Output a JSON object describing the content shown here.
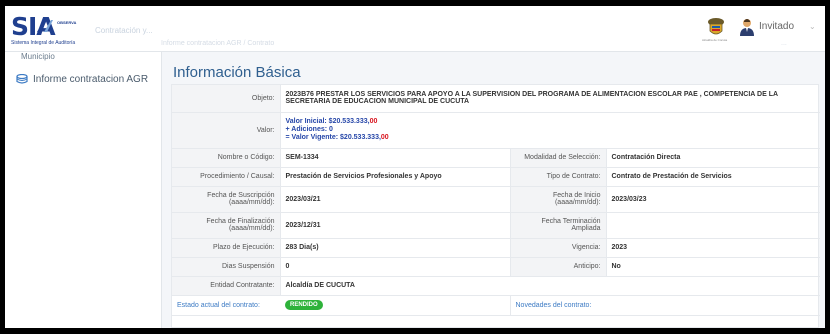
{
  "header": {
    "logo_text": "SIA",
    "logo_brand": "OBSERVA",
    "logo_subtitle": "Sistema Integral de Auditoría",
    "faded_title": "Contratación y...",
    "faded_breadcrumb": "Informe contratacion AGR / Contrato",
    "faded_right": "...",
    "user_name": "Invitado",
    "emblem_caption": "Alcaldía de Cúcuta"
  },
  "sidebar": {
    "partial_item": "Municipio",
    "items": [
      {
        "label": "Informe contratacion AGR",
        "icon": "database-icon"
      }
    ]
  },
  "main": {
    "title": "Información Básica",
    "objeto_label": "Objeto:",
    "objeto_value": "2023B76 PRESTAR LOS SERVICIOS PARA APOYO A LA SUPERVISION DEL PROGRAMA DE ALIMENTACION ESCOLAR PAE , COMPETENCIA DE LA SECRETARIA DE EDUCACION MUNICIPAL DE CUCUTA",
    "valor_label": "Valor:",
    "valor_inicial_prefix": "Valor Inicial: $20.533.333,",
    "valor_inicial_cents": "00",
    "adiciones": "+ Adiciones: 0",
    "valor_vigente_prefix": "= Valor Vigente: $20.533.333,",
    "valor_vigente_cents": "00",
    "rows": [
      {
        "l1": "Nombre o Código:",
        "v1": "SEM-1334",
        "l2": "Modalidad de Selección:",
        "v2": "Contratación Directa"
      },
      {
        "l1": "Procedimiento / Causal:",
        "v1": "Prestación de Servicios Profesionales y Apoyo",
        "l2": "Tipo de Contrato:",
        "v2": "Contrato de Prestación de Servicios"
      },
      {
        "l1": "Fecha de Suscripción (aaaa/mm/dd):",
        "v1": "2023/03/21",
        "l2": "Fecha de Inicio (aaaa/mm/dd):",
        "v2": "2023/03/23"
      },
      {
        "l1": "Fecha de Finalización (aaaa/mm/dd):",
        "v1": "2023/12/31",
        "l2": "Fecha Terminación Ampliada",
        "v2": ""
      },
      {
        "l1": "Plazo de Ejecución:",
        "v1": "283 Dia(s)",
        "l2": "Vigencia:",
        "v2": "2023"
      },
      {
        "l1": "Dias Suspensión",
        "v1": "0",
        "l2": "Anticipo:",
        "v2": "No"
      }
    ],
    "entidad_label": "Entidad Contratante:",
    "entidad_value": "Alcaldía DE CUCUTA",
    "estado_label": "Estado actual del contrato:",
    "estado_badge": "RENDIDO",
    "novedades_label": "Novedades del contrato:"
  },
  "colors": {
    "accent": "#2f5f8f",
    "link": "#3d7bc4",
    "badge_green": "#2eb23a",
    "value_blue": "#2546a8",
    "value_red": "#d9141e"
  }
}
